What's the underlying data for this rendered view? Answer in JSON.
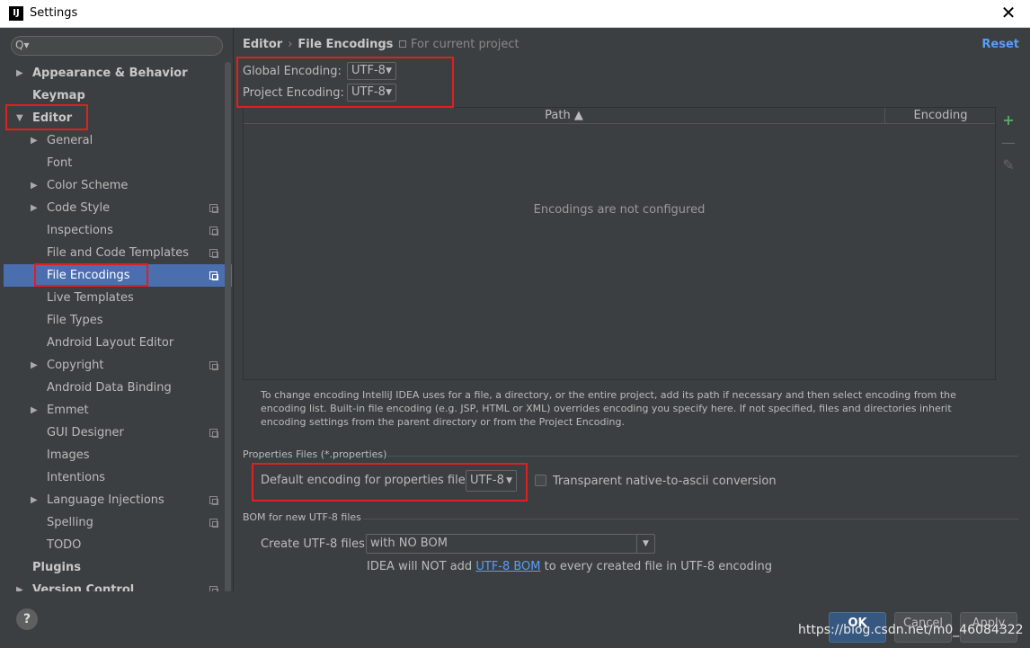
{
  "window": {
    "title": "Settings",
    "app_icon": "IJ",
    "close": "✕"
  },
  "search": {
    "placeholder": "",
    "icon": "Q▾"
  },
  "sidebar": {
    "items": [
      {
        "label": "Appearance & Behavior",
        "arrow": "▶",
        "bold": true
      },
      {
        "label": "Keymap",
        "arrow": "",
        "bold": true
      },
      {
        "label": "Editor",
        "arrow": "▼",
        "bold": true
      },
      {
        "label": "General",
        "arrow": "▶"
      },
      {
        "label": "Font",
        "arrow": ""
      },
      {
        "label": "Color Scheme",
        "arrow": "▶"
      },
      {
        "label": "Code Style",
        "arrow": "▶",
        "copy": true
      },
      {
        "label": "Inspections",
        "arrow": "",
        "copy": true
      },
      {
        "label": "File and Code Templates",
        "arrow": "",
        "copy": true
      },
      {
        "label": "File Encodings",
        "arrow": "",
        "copy": true,
        "selected": true
      },
      {
        "label": "Live Templates",
        "arrow": ""
      },
      {
        "label": "File Types",
        "arrow": ""
      },
      {
        "label": "Android Layout Editor",
        "arrow": ""
      },
      {
        "label": "Copyright",
        "arrow": "▶",
        "copy": true
      },
      {
        "label": "Android Data Binding",
        "arrow": ""
      },
      {
        "label": "Emmet",
        "arrow": "▶"
      },
      {
        "label": "GUI Designer",
        "arrow": "",
        "copy": true
      },
      {
        "label": "Images",
        "arrow": ""
      },
      {
        "label": "Intentions",
        "arrow": ""
      },
      {
        "label": "Language Injections",
        "arrow": "▶",
        "copy": true
      },
      {
        "label": "Spelling",
        "arrow": "",
        "copy": true
      },
      {
        "label": "TODO",
        "arrow": ""
      },
      {
        "label": "Plugins",
        "arrow": "",
        "bold": true
      },
      {
        "label": "Version Control",
        "arrow": "▶",
        "bold": true,
        "copy": true
      }
    ]
  },
  "breadcrumb": {
    "parent": "Editor",
    "sep": "›",
    "current": "File Encodings",
    "scope": "For current project"
  },
  "reset_label": "Reset",
  "global_encoding": {
    "label": "Global Encoding:",
    "value": "UTF-8"
  },
  "project_encoding": {
    "label": "Project Encoding:",
    "value": "UTF-8"
  },
  "table": {
    "col_path": "Path ▲",
    "col_encoding": "Encoding",
    "empty": "Encodings are not configured"
  },
  "table_buttons": {
    "add": "+",
    "remove": "—",
    "edit": "✎"
  },
  "help_text": "To change encoding IntelliJ IDEA uses for a file, a directory, or the entire project, add its path if necessary and then select encoding from the encoding list. Built-in file encoding (e.g. JSP, HTML or XML) overrides encoding you specify here. If not specified, files and directories inherit encoding settings from the parent directory or from the Project Encoding.",
  "properties": {
    "section": "Properties Files (*.properties)",
    "label": "Default encoding for properties files:",
    "value": "UTF-8",
    "transparent_label": "Transparent native-to-ascii conversion"
  },
  "bom": {
    "section": "BOM for new UTF-8 files",
    "label": "Create UTF-8 files:",
    "value": "with NO BOM",
    "note_prefix": "IDEA will NOT add ",
    "note_link": "UTF-8 BOM",
    "note_suffix": " to every created file in UTF-8 encoding"
  },
  "footer": {
    "help": "?",
    "ok": "OK",
    "cancel": "Cancel",
    "apply": "Apply"
  },
  "watermark": "https://blog.csdn.net/m0_46084322",
  "colors": {
    "accent": "#4b6eaf",
    "link": "#589df6",
    "highlight": "#e02020"
  }
}
